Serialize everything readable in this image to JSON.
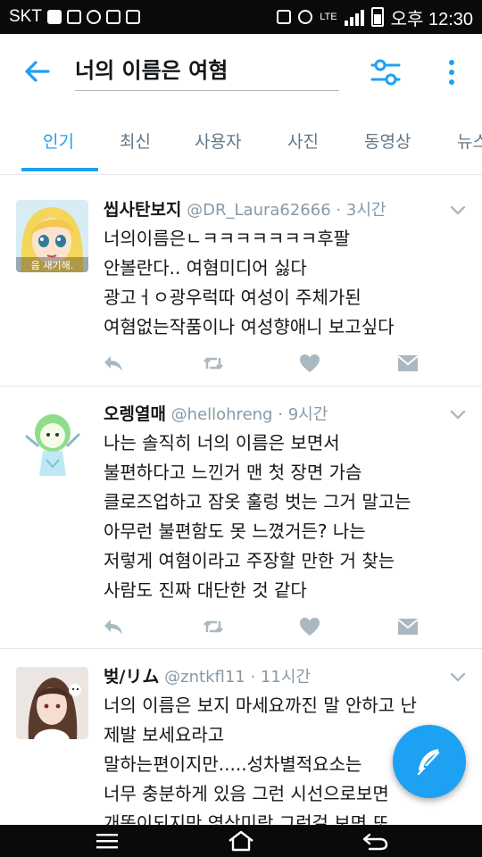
{
  "status_bar": {
    "carrier": "SKT",
    "time": "오후 12:30",
    "network": "LTE",
    "icons": [
      "notification-icon",
      "music-icon",
      "talk-icon",
      "download-icon",
      "hp-icon",
      "vibrate-icon",
      "alarm-icon",
      "signal-icon",
      "battery-icon"
    ]
  },
  "header": {
    "query": "너의 이름은 여혐"
  },
  "tabs": [
    {
      "label": "인기"
    },
    {
      "label": "최신"
    },
    {
      "label": "사용자"
    },
    {
      "label": "사진"
    },
    {
      "label": "동영상"
    },
    {
      "label": "뉴스"
    }
  ],
  "tweets": [
    {
      "name": "씹사탄보지",
      "handle": "@DR_Laura62666",
      "time": "3시간",
      "avatar_caption": "음 새기해.",
      "lines": [
        "너의이름은ㄴㅋㅋㅋㅋㅋㅋㅋ후팔",
        "안볼란다.. 여혐미디어 싫다",
        "광고ㅓㅇ광우럭따 여성이 주체가된",
        "여혐없는작품이나 여성향애니 보고싶다"
      ]
    },
    {
      "name": "오렝열매",
      "handle": "@hellohreng",
      "time": "9시간",
      "lines": [
        "나는 솔직히 너의 이름은 보면서",
        "불편하다고 느낀거 맨 첫 장면 가슴",
        "클로즈업하고 잠옷 훌렁 벗는 그거 말고는",
        "아무런 불편함도 못 느꼈거든? 나는",
        "저렇게 여혐이라고 주장할 만한 거 찾는",
        "사람도 진짜 대단한 것 같다"
      ]
    },
    {
      "name": "벚/リム",
      "handle": "@zntkfl11",
      "time": "11시간",
      "lines": [
        "너의 이름은 보지 마세요까진 말 안하고 난",
        "제발 보세요라고",
        "말하는편이지만.....성차별적요소는",
        "너무 충분하게 있음 그런 시선으로보면",
        "개똥이되지만 영상미랑 그런걸 보면 또"
      ]
    }
  ],
  "colors": {
    "accent": "#1da1f2",
    "text_primary": "#14171a",
    "text_secondary": "#8899a6",
    "action_icon": "#aab8c2",
    "divider": "#e1e8ed",
    "system_bar": "#0a0a0a"
  }
}
